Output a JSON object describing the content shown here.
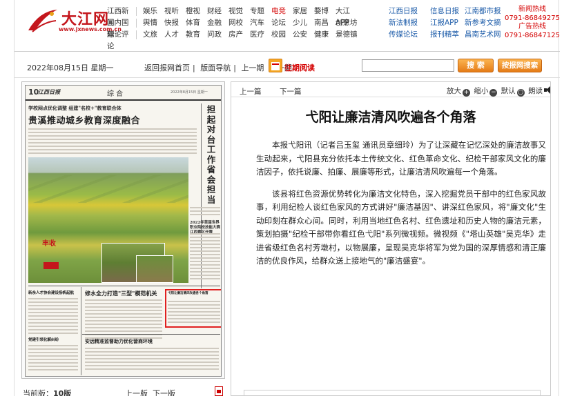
{
  "header": {
    "logo_text": "大江网",
    "logo_url": "www.jxnews.com.cn",
    "nav_rows": [
      [
        "江西新闻",
        "娱乐",
        "视听",
        "橙视",
        "财经",
        "视觉",
        "专题",
        "电竞",
        "家居",
        "婺博",
        "大江APP"
      ],
      [
        "国内国际",
        "舆情",
        "快报",
        "体育",
        "金融",
        "网校",
        "汽车",
        "论坛",
        "少儿",
        "南昌",
        "创意坊"
      ],
      [
        "理论评论",
        "文旅",
        "人才",
        "教育",
        "问政",
        "房产",
        "医疗",
        "校园",
        "公安",
        "健康",
        "景德镇"
      ]
    ],
    "nav_blue_col1": [
      "江西日报",
      "新法制报",
      "传媒论坛"
    ],
    "nav_blue_col2": [
      "信息日报",
      "江报APP",
      "报刊精萃"
    ],
    "nav_blue_col3": [
      "江南都市报",
      "新参考文摘",
      "昌南艺术网"
    ],
    "hotline": [
      "新闻热线",
      "0791-86849275",
      "广告热线",
      "0791-86847125"
    ]
  },
  "toolbar": {
    "date": "2022年08月15日 星期一",
    "links": [
      "返回报网首页",
      "版面导航",
      "上一期",
      "下一期"
    ],
    "history_label": "往期阅读",
    "search_value": "",
    "search_button": "搜 索",
    "search_site_button": "按报网搜索"
  },
  "paper": {
    "page_number": "10",
    "paper_name": "江西日报",
    "section": "综 合",
    "meta": "2022年8月15日 星期一",
    "kicker": "学校网点优化调整 组建\"名校+\"教育联合体",
    "headline": "贵溪推动城乡教育深度融合",
    "right_column": "担起对台工作省会担当",
    "stamp_text": "丰收",
    "sidebox_title": "2022年首届世界职业院校技能大赛江西赛区开赛",
    "headline_mid": "修水全力打造\"三型\"模范机关",
    "headline_left_small": "新余人才协会建设扬帆起航",
    "headline_left_small2": "党建引领化解纠纷",
    "headline_bottom": "安远精准监督助力优化营商环境",
    "highlight_title": "弋阳让廉洁清风吹遍各个角落"
  },
  "left_footer": {
    "current_label": "当前版：",
    "current_page": "10版",
    "prev": "上一版",
    "next": "下一版"
  },
  "article": {
    "prev": "上一篇",
    "next": "下一篇",
    "tools": {
      "zoom_in": "放大",
      "zoom_out": "缩小",
      "default": "默认",
      "read": "朗读"
    },
    "title": "弋阳让廉洁清风吹遍各个角落",
    "paragraphs": [
      "本报弋阳讯（记者吕玉玺 通讯员章细玲）为了让深藏在记忆深处的廉洁故事又生动起来，弋阳县充分依托本土传统文化、红色革命文化、纪检干部家风文化的廉洁因子，依托说廉、拍廉、展廉等形式，让廉洁清风吹遍每一个角落。",
      "该县将红色资源优势转化为廉洁文化特色，深入挖掘党员干部中的红色家风故事，利用纪检人谈红色家风的方式讲好\"廉洁基因\"、讲深红色家风，将\"廉文化\"生动印刻在群众心间。同时，利用当地红色名村、红色遗址和历史人物的廉洁元素，策划拍摄\"纪检干部带你看红色弋阳\"系列微视频。微视频《\"塔山英雄\"吴克华》走进省级红色名村芳墩村，以物展廉，呈现吴克华将军为党为国的深厚情感和清正廉洁的优良作风，给群众送上接地气的\"廉洁盛宴\"。"
    ]
  }
}
